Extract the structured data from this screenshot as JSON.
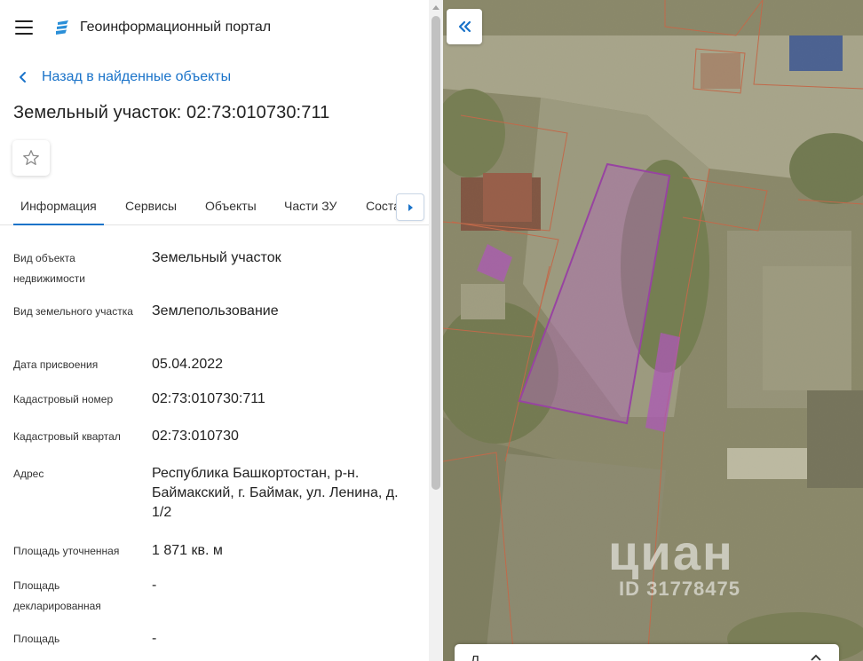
{
  "header": {
    "title": "Геоинформационный портал"
  },
  "nav": {
    "back_label": "Назад в найденные объекты"
  },
  "object": {
    "title": "Земельный участок: 02:73:010730:711"
  },
  "tabs": [
    {
      "label": "Информация",
      "active": true
    },
    {
      "label": "Сервисы",
      "active": false
    },
    {
      "label": "Объекты",
      "active": false
    },
    {
      "label": "Части ЗУ",
      "active": false
    },
    {
      "label": "Состав",
      "active": false
    }
  ],
  "properties": [
    {
      "label": "Вид объекта недвижимости",
      "value": "Земельный участок"
    },
    {
      "label": "Вид земельного участка",
      "value": "Землепользование"
    },
    {
      "label": "Дата присвоения",
      "value": "05.04.2022"
    },
    {
      "label": "Кадастровый номер",
      "value": "02:73:010730:711"
    },
    {
      "label": "Кадастровый квартал",
      "value": "02:73:010730"
    },
    {
      "label": "Адрес",
      "value": "Республика Башкортостан, р-н. Баймакский, г. Баймак, ул. Ленина, д. 1/2"
    },
    {
      "label": "Площадь уточненная",
      "value": "1 871 кв. м"
    },
    {
      "label": "Площадь декларированная",
      "value": "-"
    },
    {
      "label": "Площадь",
      "value": "-"
    }
  ],
  "map": {
    "watermark_brand": "циан",
    "watermark_id": "ID 31778475",
    "bottom_card_label": "Л",
    "colors": {
      "parcel_outline": "#a020c0",
      "parcel_fill": "#c060d8",
      "boundary": "#e05a3a",
      "accent": "#1a73c9"
    }
  },
  "icons": {
    "menu": "hamburger-icon",
    "logo": "portal-logo-icon",
    "back": "chevron-left-icon",
    "favorite": "star-outline-icon",
    "tab_next": "caret-right-icon",
    "collapse": "double-chevron-left-icon",
    "card_toggle": "chevron-up-icon"
  }
}
